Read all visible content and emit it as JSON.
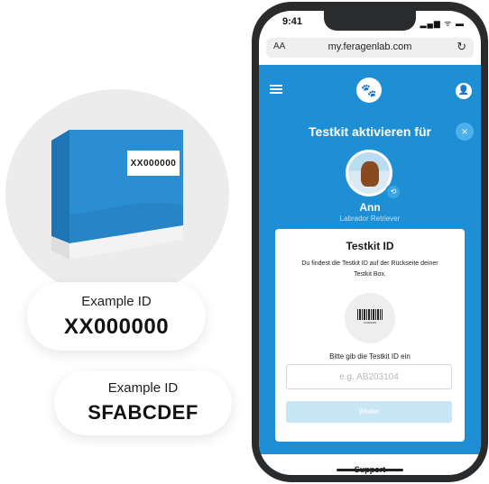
{
  "illustration": {
    "box_label": "XX000000",
    "examples": [
      {
        "caption": "Example ID",
        "id": "XX000000"
      },
      {
        "caption": "Example ID",
        "id": "SFABCDEF"
      }
    ]
  },
  "phone": {
    "status": {
      "time": "9:41",
      "icons": "▂▄▆ ᯤ ▬"
    },
    "browser": {
      "aa_label": "AA",
      "url": "my.feragenlab.com",
      "reload_icon": "↻"
    },
    "header": {
      "menu_icon": "hamburger-icon",
      "logo_icon": "paw-icon",
      "user_icon": "user-icon"
    },
    "modal": {
      "title": "Testkit aktivieren für",
      "close_icon": "×",
      "pet": {
        "name": "Ann",
        "breed": "Labrador Retriever"
      },
      "card": {
        "title": "Testkit ID",
        "description": "Du findest die Testkit ID auf der Rückseite deiner Testkit Box.",
        "barcode_text": "XX000000",
        "input_label": "Bitte gib die Testkit ID ein",
        "input_placeholder": "e.g. AB203104",
        "submit_label": "Weiter"
      }
    },
    "footer": {
      "support_label": "Support"
    }
  },
  "colors": {
    "brand_blue": "#1e8fd5",
    "box_blue": "#2b8ed3",
    "disabled_button": "#c9e6f7"
  }
}
